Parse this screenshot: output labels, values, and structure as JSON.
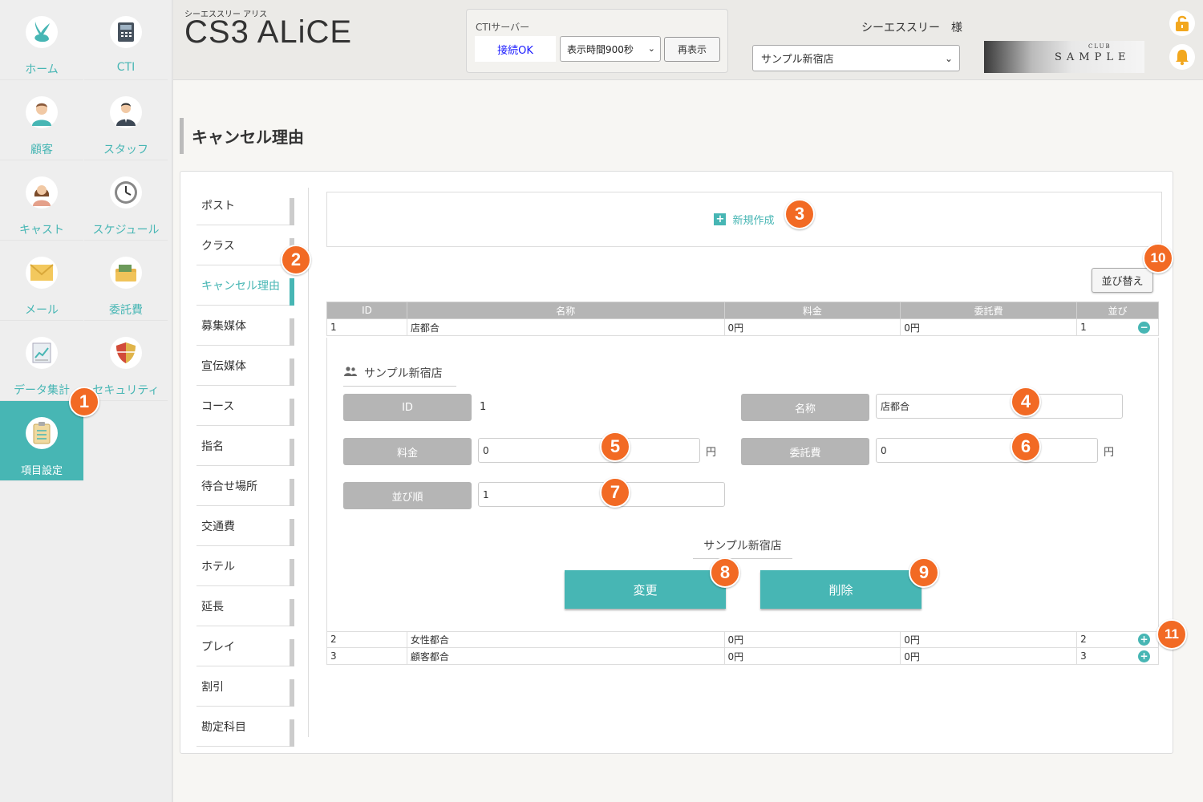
{
  "app": {
    "subtitle": "シーエススリー アリス",
    "title": "CS3 ALiCE"
  },
  "nav": {
    "items": [
      {
        "label": "ホーム",
        "icon": "rabbit-icon"
      },
      {
        "label": "CTI",
        "icon": "phone-icon"
      },
      {
        "label": "顧客",
        "icon": "customer-icon"
      },
      {
        "label": "スタッフ",
        "icon": "staff-icon"
      },
      {
        "label": "キャスト",
        "icon": "cast-icon"
      },
      {
        "label": "スケジュール",
        "icon": "clock-icon"
      },
      {
        "label": "メール",
        "icon": "mail-icon"
      },
      {
        "label": "委託費",
        "icon": "wallet-icon"
      },
      {
        "label": "データ集計",
        "icon": "chart-icon"
      },
      {
        "label": "セキュリティ",
        "icon": "shield-icon"
      },
      {
        "label": "項目設定",
        "icon": "clipboard-icon"
      }
    ]
  },
  "cti": {
    "label": "CTIサーバー",
    "status": "接続OK",
    "display_time": "表示時間900秒",
    "refresh_label": "再表示"
  },
  "header": {
    "user": "シーエススリー　様",
    "store": "サンプル新宿店",
    "logo_club": "CLUB",
    "logo_text": "SAMPLE"
  },
  "page": {
    "title": "キャンセル理由"
  },
  "subnav": {
    "items": [
      "ポスト",
      "クラス",
      "キャンセル理由",
      "募集媒体",
      "宣伝媒体",
      "コース",
      "指名",
      "待合せ場所",
      "交通費",
      "ホテル",
      "延長",
      "プレイ",
      "割引",
      "勘定科目"
    ],
    "active": "キャンセル理由"
  },
  "main": {
    "new_label": "新規作成",
    "sort_label": "並び替え",
    "columns": [
      "ID",
      "名称",
      "料金",
      "委託費",
      "並び"
    ],
    "rows": [
      {
        "id": "1",
        "name": "店都合",
        "fee": "0円",
        "commission": "0円",
        "order": "1",
        "btn": "−"
      },
      {
        "id": "2",
        "name": "女性都合",
        "fee": "0円",
        "commission": "0円",
        "order": "2",
        "btn": "+"
      },
      {
        "id": "3",
        "name": "顧客都合",
        "fee": "0円",
        "commission": "0円",
        "order": "3",
        "btn": "+"
      }
    ]
  },
  "detail": {
    "store": "サンプル新宿店",
    "id_label": "ID",
    "id_value": "1",
    "name_label": "名称",
    "name_value": "店都合",
    "fee_label": "料金",
    "fee_value": "0",
    "commission_label": "委託費",
    "commission_value": "0",
    "order_label": "並び順",
    "order_value": "1",
    "unit": "円",
    "footer_store": "サンプル新宿店",
    "change_label": "変更",
    "delete_label": "削除"
  },
  "badges": [
    "1",
    "2",
    "3",
    "4",
    "5",
    "6",
    "7",
    "8",
    "9",
    "10",
    "11"
  ],
  "colors": {
    "accent": "#47b6b4",
    "badge": "#f26a24",
    "label_gray": "#b5b5b5"
  }
}
